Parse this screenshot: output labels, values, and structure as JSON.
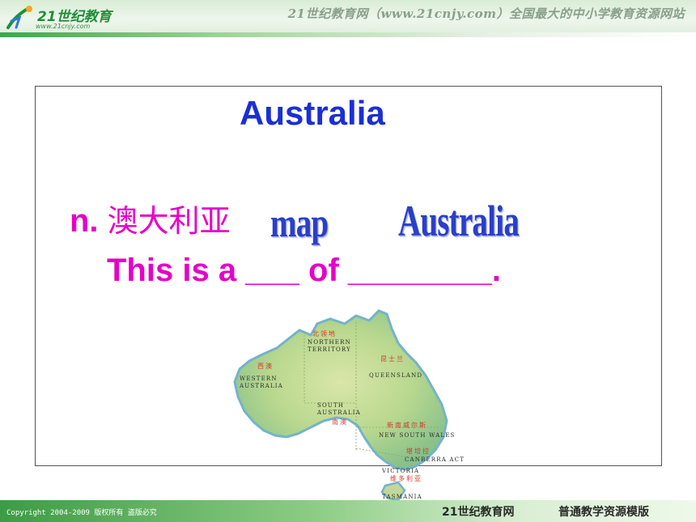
{
  "header": {
    "logo_text": "21世纪教育",
    "logo_url": "www.21cnjy.com",
    "slogan": "21世纪教育网（www.21cnjy.com）全国最大的中小学教育资源网站"
  },
  "slide": {
    "title": "Australia",
    "vocab_pos": "n.",
    "vocab_cn": "澳大利亚",
    "word_map": "map",
    "word_australia": "Australia",
    "sentence": "This is a ___ of ________."
  },
  "map": {
    "land_color": "#a8cf8c",
    "coast_color": "#74b3c9",
    "labels": {
      "nt_cn": "北领地",
      "nt_en_1": "NORTHERN",
      "nt_en_2": "TERRITORY",
      "qld_cn": "昆士兰",
      "qld_en": "QUEENSLAND",
      "wa_cn": "西澳",
      "wa_en_1": "WESTERN",
      "wa_en_2": "AUSTRALIA",
      "sa_en_1": "SOUTH",
      "sa_en_2": "AUSTRALIA",
      "sa_cn": "南澳",
      "nsw_cn": "新南威尔斯",
      "nsw_en": "NEW SOUTH WALES",
      "act_cn": "堪培拉",
      "act_en": "CANBERRA ACT",
      "vic_en": "VICTORIA",
      "vic_cn": "维多利亚",
      "tas_en": "TASMANIA"
    }
  },
  "footer": {
    "copyright": "Copyright 2004-2009 版权所有 盗版必究",
    "brand": "21世纪教育网",
    "subtitle": "普通教学资源模版"
  },
  "colors": {
    "title": "#1a2fd6",
    "magenta": "#e600c8",
    "green": "#3d9b45"
  }
}
